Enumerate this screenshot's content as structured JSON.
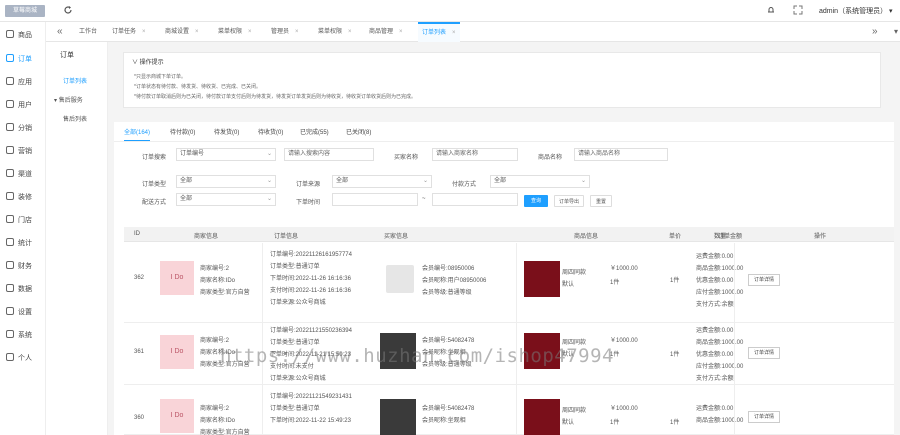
{
  "brand": {
    "label": "草莓商城"
  },
  "header": {
    "admin_label": "admin（系统管理员）"
  },
  "sidebar": {
    "items": [
      {
        "label": "商品"
      },
      {
        "label": "订单"
      },
      {
        "label": "应用"
      },
      {
        "label": "用户"
      },
      {
        "label": "分销"
      },
      {
        "label": "营销"
      },
      {
        "label": "渠道"
      },
      {
        "label": "装修"
      },
      {
        "label": "门店"
      },
      {
        "label": "统计"
      },
      {
        "label": "财务"
      },
      {
        "label": "数据"
      },
      {
        "label": "设置"
      },
      {
        "label": "系统"
      },
      {
        "label": "个人"
      }
    ]
  },
  "sub_sidebar": {
    "title": "订单",
    "items": [
      {
        "label": "订单列表"
      },
      {
        "label": "售后服务"
      },
      {
        "label": "售后列表"
      }
    ]
  },
  "tabs": [
    {
      "label": "工作台"
    },
    {
      "label": "订单任务"
    },
    {
      "label": "商城设置"
    },
    {
      "label": "菜单权限"
    },
    {
      "label": "管理员"
    },
    {
      "label": "菜单权限"
    },
    {
      "label": "商品管理"
    },
    {
      "label": "订单列表"
    }
  ],
  "tips": {
    "title": "操作提示",
    "lines": [
      "*只显示商城下单订单。",
      "*订单状态有待付款、待发货、待收货、已完成、已关闭。",
      "*待付款订单取消后则为已关闭，待付款订单支付后则为待发货，待发货订单发货后则为待收货，待收货订单收货后则为已完成。"
    ]
  },
  "status_tabs": [
    {
      "label": "全部(164)"
    },
    {
      "label": "待付款(0)"
    },
    {
      "label": "待发货(0)"
    },
    {
      "label": "待收货(0)"
    },
    {
      "label": "已完成(55)"
    },
    {
      "label": "已关闭(8)"
    }
  ],
  "filters": {
    "order_search_label": "订单搜索",
    "order_search_value": "订单编号",
    "order_search_placeholder": "请输入搜索内容",
    "buyer_label": "买家名称",
    "buyer_placeholder": "请输入商家名称",
    "goods_label": "商品名称",
    "goods_placeholder": "请输入商品名称",
    "order_type_label": "订单类型",
    "order_type_value": "全部",
    "source_label": "订单来源",
    "source_value": "全部",
    "pay_label": "付款方式",
    "pay_value": "全部",
    "delivery_label": "配送方式",
    "delivery_value": "全部",
    "time_label": "下单时间",
    "search_btn": "查询",
    "export_btn": "订单导出",
    "reset_btn": "重置"
  },
  "table": {
    "headers": [
      "ID",
      "商家信息",
      "订单信息",
      "买家信息",
      "商品信息",
      "单价",
      "数量",
      "订单金额",
      "操作"
    ],
    "rows": [
      {
        "id": "362",
        "logo": "I Do",
        "merchant": [
          "商家编号:2",
          "商家名称:IDo",
          "商家类型:官方自营"
        ],
        "order": [
          "订单编号:20221126161957774",
          "订单类型:普通订单",
          "下单时间:2022-11-26 16:16:36",
          "支付时间:2022-11-26 16:16:36",
          "订单来源:公众号商城"
        ],
        "buyer": [
          "会员编号:08950006",
          "会员昵称:用户08950006",
          "会员等级:普通等级"
        ],
        "goods_name": "周四同款",
        "goods_spec": "默认",
        "price": "￥1000.00",
        "count": "1件",
        "qty": "1件",
        "amount": [
          "运费金额:0.00",
          "商品金额:1000.00",
          "优惠金额:0.00",
          "应付金额:1000.00",
          "支付方式:余额"
        ],
        "detail_btn": "订单详情"
      },
      {
        "id": "361",
        "logo": "I Do",
        "merchant": [
          "商家编号:2",
          "商家名称:IDo",
          "商家类型:官方自营"
        ],
        "order": [
          "订单编号:20221121550236394",
          "订单类型:普通订单",
          "下单时间:2022-11-21 15:50:23",
          "支付时间:未支付",
          "订单来源:公众号商城"
        ],
        "buyer": [
          "会员编号:54082478",
          "会员昵称:坐观相",
          "会员等级:普通等级"
        ],
        "goods_name": "周四同款",
        "goods_spec": "默认",
        "price": "￥1000.00",
        "count": "1件",
        "qty": "1件",
        "amount": [
          "运费金额:0.00",
          "商品金额:1000.00",
          "优惠金额:0.00",
          "应付金额:1000.00",
          "支付方式:余额"
        ],
        "detail_btn": "订单详情"
      },
      {
        "id": "360",
        "logo": "I Do",
        "merchant": [
          "商家编号:2",
          "商家名称:IDo",
          "商家类型:官方自营"
        ],
        "order": [
          "订单编号:20221121549231431",
          "订单类型:普通订单",
          "下单时间:2022-11-22 15:49:23"
        ],
        "buyer": [
          "会员编号:54082478",
          "会员昵称:坐观相"
        ],
        "goods_name": "周四同款",
        "goods_spec": "默认",
        "price": "￥1000.00",
        "count": "1件",
        "qty": "1件",
        "amount": [
          "运费金额:0.00",
          "商品金额:1000.00"
        ],
        "detail_btn": "订单详情"
      }
    ]
  },
  "watermark": "https://www.huzhan.com/ishop47994"
}
